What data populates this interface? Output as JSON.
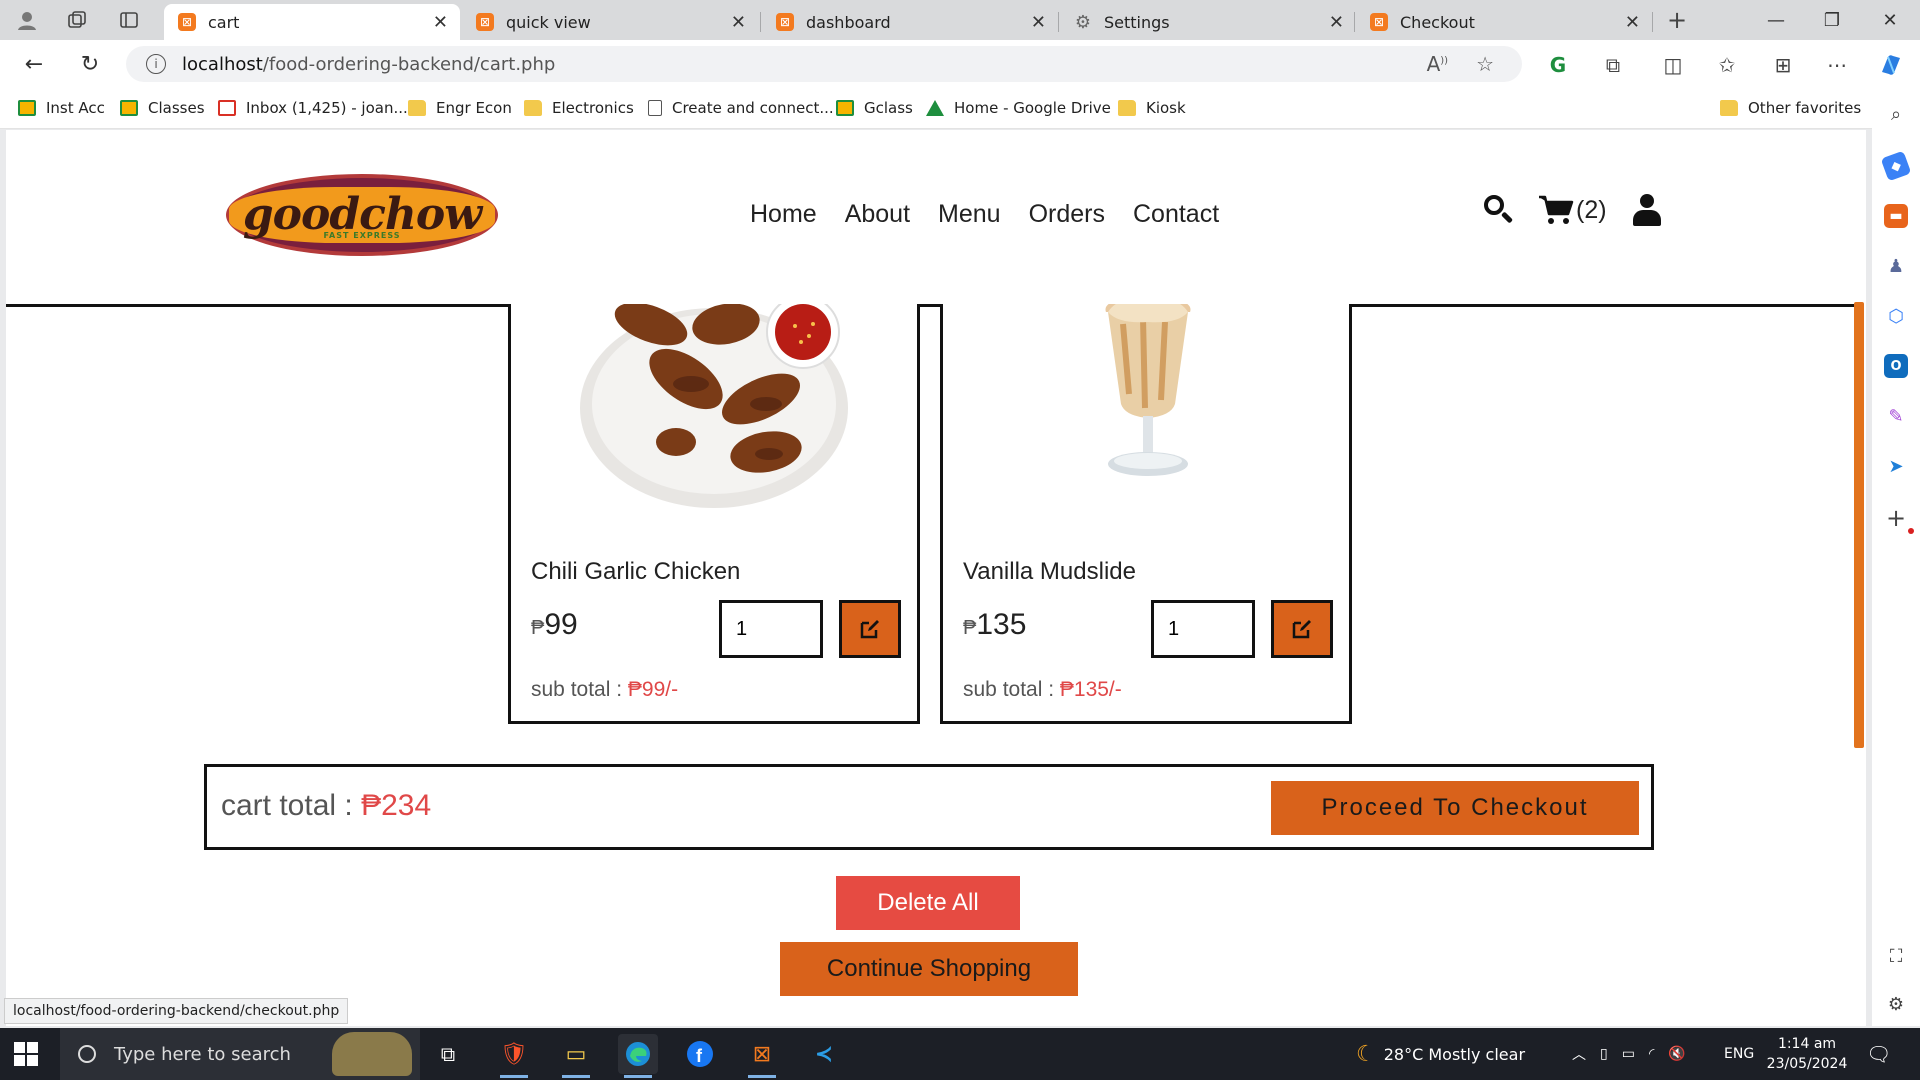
{
  "browser": {
    "tabs": [
      {
        "title": "cart",
        "active": true
      },
      {
        "title": "quick view",
        "active": false
      },
      {
        "title": "dashboard",
        "active": false
      },
      {
        "title": "Settings",
        "active": false
      },
      {
        "title": "Checkout",
        "active": false
      }
    ],
    "address": {
      "host": "localhost",
      "path": "/food-ordering-backend/cart.php"
    },
    "bookmarks": [
      {
        "label": "Inst Acc",
        "icon": "classroom-icon"
      },
      {
        "label": "Classes",
        "icon": "classroom-icon"
      },
      {
        "label": "Inbox (1,425) - joan...",
        "icon": "gmail-icon"
      },
      {
        "label": "Engr Econ",
        "icon": "folder-icon"
      },
      {
        "label": "Electronics",
        "icon": "folder-icon"
      },
      {
        "label": "Create and connect...",
        "icon": "doc-icon"
      },
      {
        "label": "Gclass",
        "icon": "classroom-icon"
      },
      {
        "label": "Home - Google Drive",
        "icon": "drive-icon"
      },
      {
        "label": "Kiosk",
        "icon": "folder-icon"
      }
    ],
    "other_favorites": "Other favorites",
    "status_url": "localhost/food-ordering-backend/checkout.php"
  },
  "site": {
    "logo_text": "goodchow",
    "logo_sub": "FAST EXPRESS",
    "nav": [
      "Home",
      "About",
      "Menu",
      "Orders",
      "Contact"
    ],
    "cart_count": "(2)"
  },
  "cart": {
    "items": [
      {
        "name": "Chili Garlic Chicken",
        "currency": "₱",
        "price": "99",
        "qty": "1",
        "subtotal_label": "sub total : ",
        "subtotal": "₱99/-"
      },
      {
        "name": "Vanilla Mudslide",
        "currency": "₱",
        "price": "135",
        "qty": "1",
        "subtotal_label": "sub total : ",
        "subtotal": "₱135/-"
      }
    ],
    "total_label": "cart total : ",
    "total": "₱234",
    "checkout_label": "Proceed To Checkout",
    "delete_all_label": "Delete All",
    "continue_label": "Continue Shopping"
  },
  "taskbar": {
    "search_placeholder": "Type here to search",
    "weather": "28°C  Mostly clear",
    "lang": "ENG",
    "time": "1:14 am",
    "date": "23/05/2024"
  },
  "colors": {
    "accent_orange": "#d9621b",
    "delete_red": "#e64b42",
    "price_red": "#e04848"
  }
}
